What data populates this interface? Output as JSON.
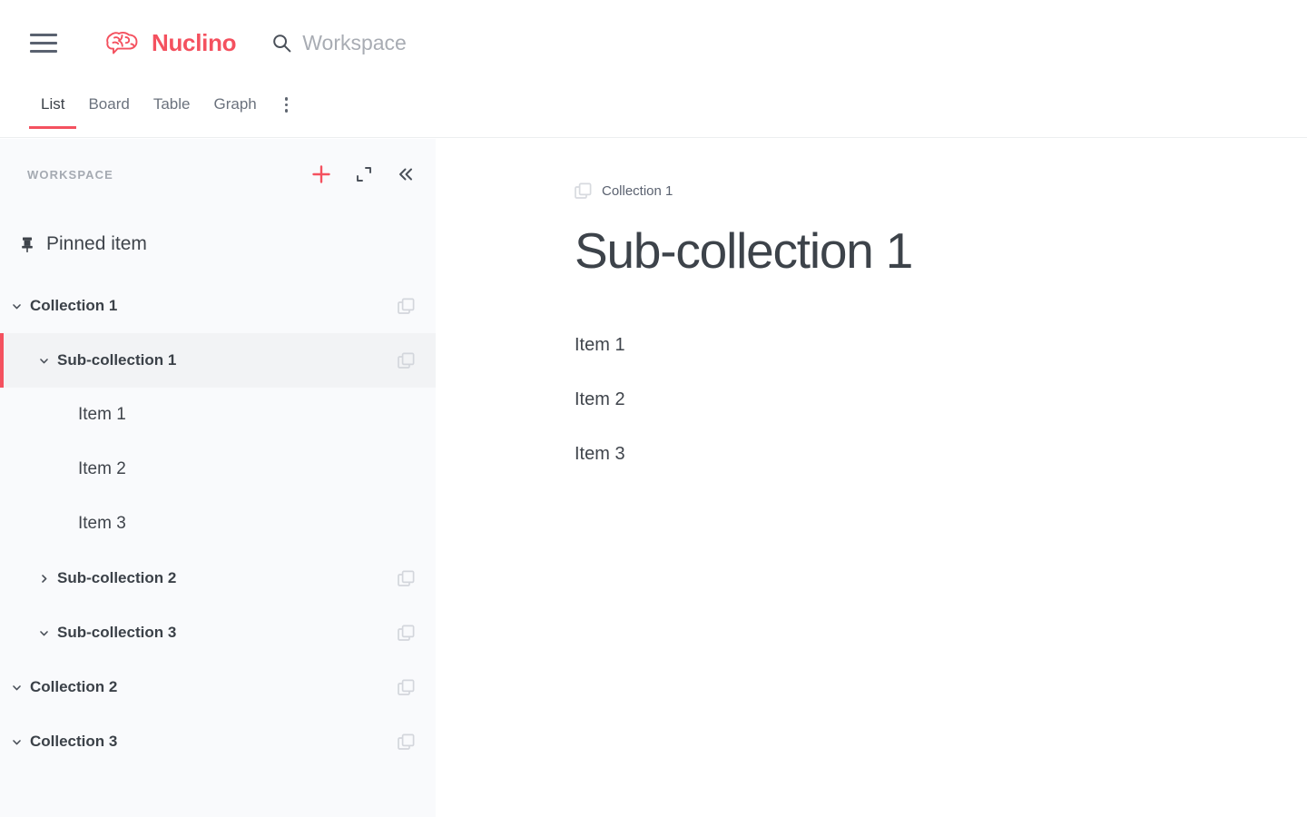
{
  "colors": {
    "brand": "#f4515f",
    "sidebar_bg": "#f9fafc",
    "selected_row_bg": "#f2f3f5",
    "text_primary": "#3b4148",
    "text_muted": "#6b727d",
    "icon_gray": "#cdd1d6"
  },
  "topbar": {
    "menu_icon": "hamburger-menu-icon",
    "brand_name": "Nuclino",
    "brand_icon": "nuclino-brain-logo-icon",
    "search": {
      "icon": "search-icon",
      "placeholder": "Workspace",
      "value": ""
    }
  },
  "tabs": {
    "items": [
      {
        "label": "List",
        "active": true
      },
      {
        "label": "Board",
        "active": false
      },
      {
        "label": "Table",
        "active": false
      },
      {
        "label": "Graph",
        "active": false
      }
    ],
    "more_icon": "more-vertical-icon"
  },
  "sidebar": {
    "title": "WORKSPACE",
    "actions": [
      {
        "name": "add-button",
        "icon": "plus-icon"
      },
      {
        "name": "expand-button",
        "icon": "expand-icon"
      },
      {
        "name": "collapse-sidebar-button",
        "icon": "chevron-double-left-icon"
      }
    ],
    "pinned": {
      "icon": "pin-icon",
      "label": "Pinned item"
    },
    "tree": [
      {
        "label": "Collection 1",
        "type": "collection",
        "depth": 0,
        "expanded": true,
        "selected": false,
        "icon": "collection-icon"
      },
      {
        "label": "Sub-collection 1",
        "type": "collection",
        "depth": 1,
        "expanded": true,
        "selected": true,
        "icon": "collection-icon"
      },
      {
        "label": "Item 1",
        "type": "item",
        "depth": 2,
        "expanded": null,
        "selected": false,
        "icon": null
      },
      {
        "label": "Item 2",
        "type": "item",
        "depth": 2,
        "expanded": null,
        "selected": false,
        "icon": null
      },
      {
        "label": "Item 3",
        "type": "item",
        "depth": 2,
        "expanded": null,
        "selected": false,
        "icon": null
      },
      {
        "label": "Sub-collection 2",
        "type": "collection",
        "depth": 1,
        "expanded": false,
        "selected": false,
        "icon": "collection-icon"
      },
      {
        "label": "Sub-collection 3",
        "type": "collection",
        "depth": 1,
        "expanded": true,
        "selected": false,
        "icon": "collection-icon"
      },
      {
        "label": "Collection 2",
        "type": "collection",
        "depth": 0,
        "expanded": true,
        "selected": false,
        "icon": "collection-icon"
      },
      {
        "label": "Collection 3",
        "type": "collection",
        "depth": 0,
        "expanded": true,
        "selected": false,
        "icon": "collection-icon"
      }
    ]
  },
  "main": {
    "breadcrumb": {
      "icon": "collection-icon",
      "label": "Collection 1"
    },
    "title": "Sub-collection 1",
    "items": [
      {
        "label": "Item 1"
      },
      {
        "label": "Item 2"
      },
      {
        "label": "Item 3"
      }
    ]
  }
}
